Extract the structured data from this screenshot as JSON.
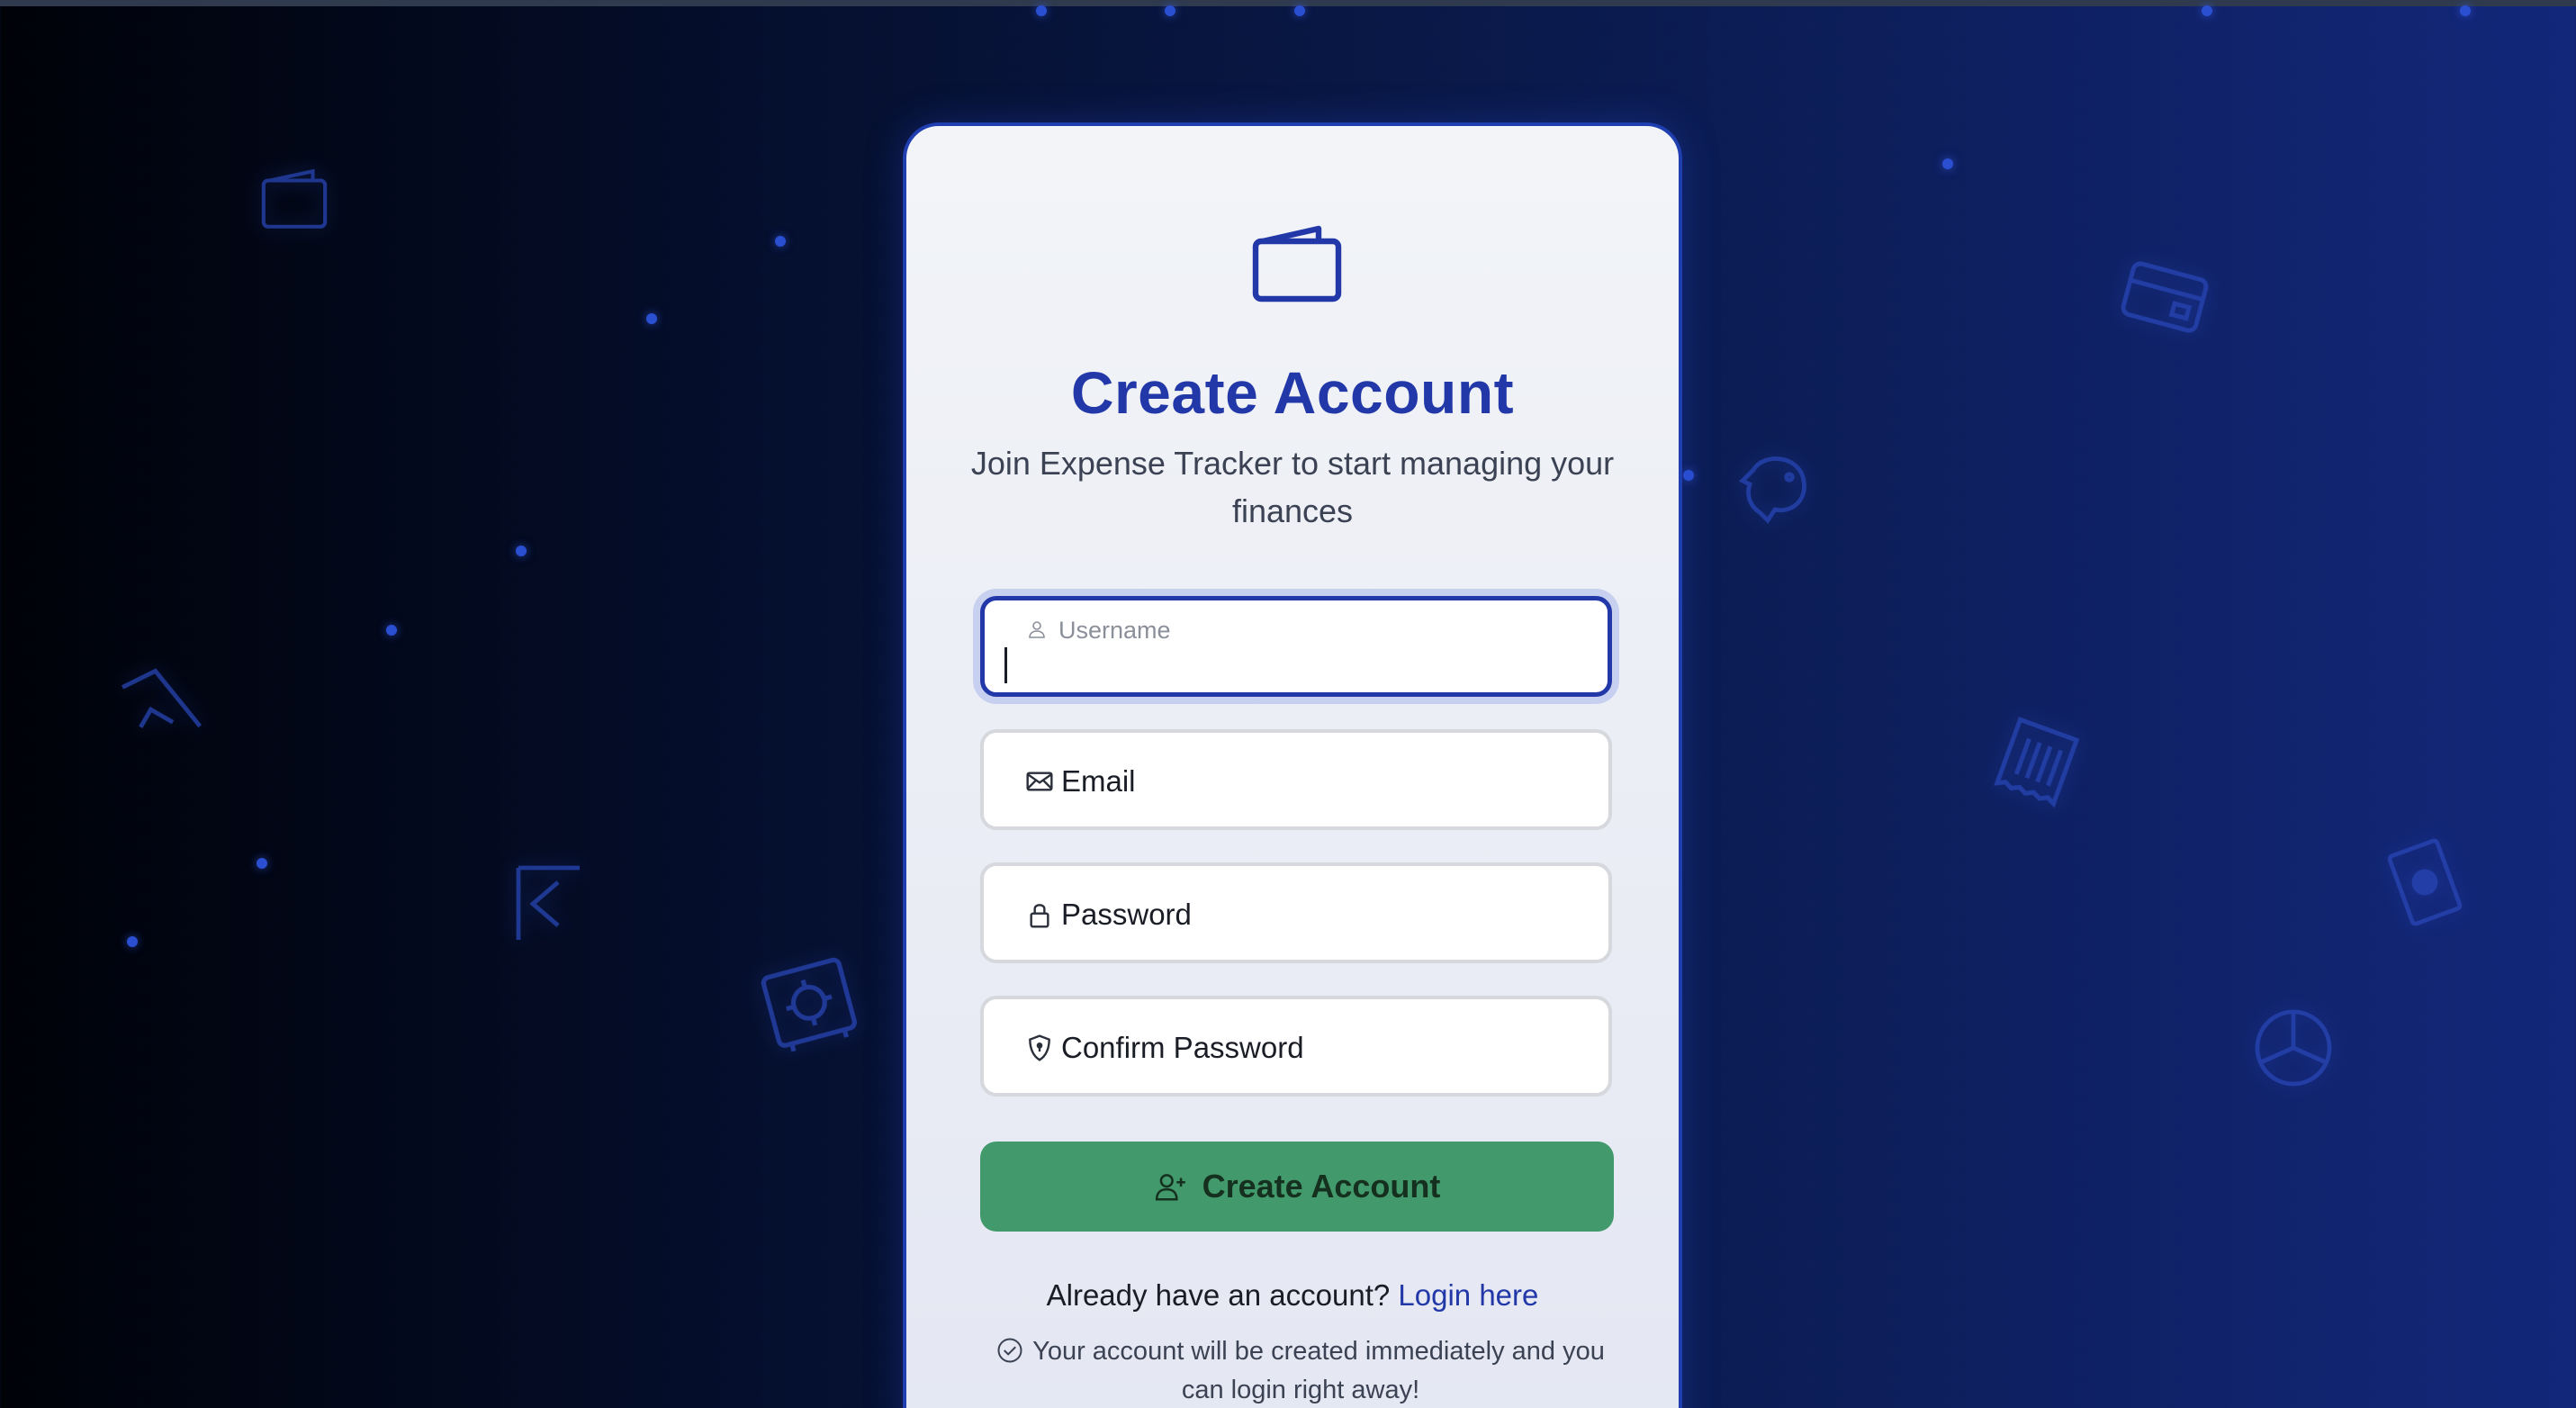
{
  "header": {
    "title": "Create Account",
    "subtitle": "Join Expense Tracker to start managing your finances"
  },
  "form": {
    "username": {
      "placeholder": "Username",
      "value": "",
      "icon": "user-icon"
    },
    "email": {
      "placeholder": "Email",
      "icon": "envelope-icon"
    },
    "password": {
      "placeholder": "Password",
      "icon": "lock-icon"
    },
    "confirm_password": {
      "placeholder": "Confirm Password",
      "icon": "shield-icon"
    },
    "submit_label": "Create Account"
  },
  "footer": {
    "login_prompt": "Already have an account?",
    "login_link": "Login here",
    "note": "Your account will be created immediately and you can login right away!"
  },
  "colors": {
    "primary": "#2238a8",
    "success": "#42996b",
    "background_dark": "#000208",
    "background_blue": "#13277a"
  }
}
